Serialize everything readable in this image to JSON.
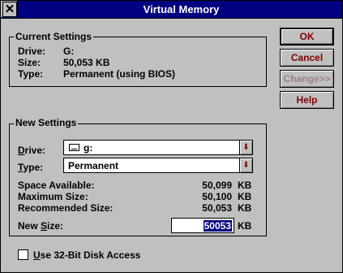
{
  "window": {
    "title": "Virtual Memory"
  },
  "current": {
    "group_title": "Current Settings",
    "drive_label": "Drive:",
    "drive_value": "G:",
    "size_label": "Size:",
    "size_value": "50,053 KB",
    "type_label": "Type:",
    "type_value": "Permanent (using BIOS)"
  },
  "buttons": {
    "ok": "OK",
    "cancel": "Cancel",
    "change": "Change>>",
    "help": "Help"
  },
  "new_settings": {
    "group_title": "New Settings",
    "drive_label": "Drive:",
    "drive_value": "g:",
    "type_label": "Type:",
    "type_value": "Permanent",
    "space_label": "Space Available:",
    "space_value": "50,099",
    "max_label": "Maximum Size:",
    "max_value": "50,100",
    "rec_label": "Recommended Size:",
    "rec_value": "50,053",
    "unit": "KB",
    "new_size_label": "New Size:",
    "new_size_value": "50053"
  },
  "checkbox": {
    "label": "Use 32-Bit Disk Access",
    "checked": false
  }
}
